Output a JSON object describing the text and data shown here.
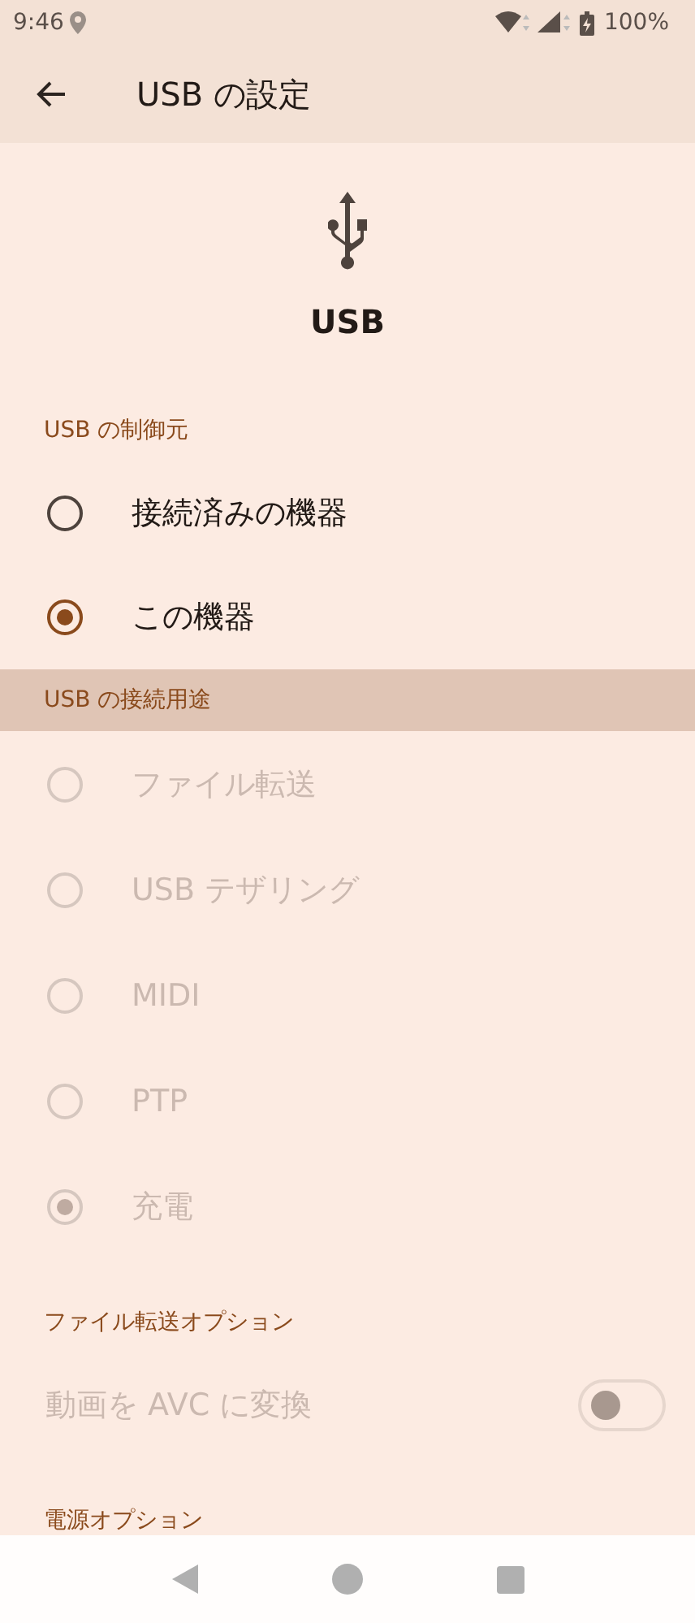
{
  "status_bar": {
    "time": "9:46",
    "battery": "100%"
  },
  "toolbar": {
    "title": "USB の設定"
  },
  "header": {
    "title": "USB"
  },
  "sections": [
    {
      "title": "USB の制御元",
      "highlighted": false,
      "items": [
        {
          "kind": "radio",
          "label": "接続済みの機器",
          "selected": false,
          "disabled": false
        },
        {
          "kind": "radio",
          "label": "この機器",
          "selected": true,
          "disabled": false
        }
      ]
    },
    {
      "title": "USB の接続用途",
      "highlighted": true,
      "items": [
        {
          "kind": "radio",
          "label": "ファイル転送",
          "selected": false,
          "disabled": true
        },
        {
          "kind": "radio",
          "label": "USB テザリング",
          "selected": false,
          "disabled": true
        },
        {
          "kind": "radio",
          "label": "MIDI",
          "selected": false,
          "disabled": true
        },
        {
          "kind": "radio",
          "label": "PTP",
          "selected": false,
          "disabled": true
        },
        {
          "kind": "radio",
          "label": "充電",
          "selected": true,
          "disabled": true
        }
      ]
    },
    {
      "title": "ファイル転送オプション",
      "highlighted": false,
      "items": [
        {
          "kind": "switch",
          "label": "動画を AVC に変換",
          "on": false,
          "disabled": true
        }
      ]
    },
    {
      "title": "電源オプション",
      "highlighted": false
    }
  ]
}
